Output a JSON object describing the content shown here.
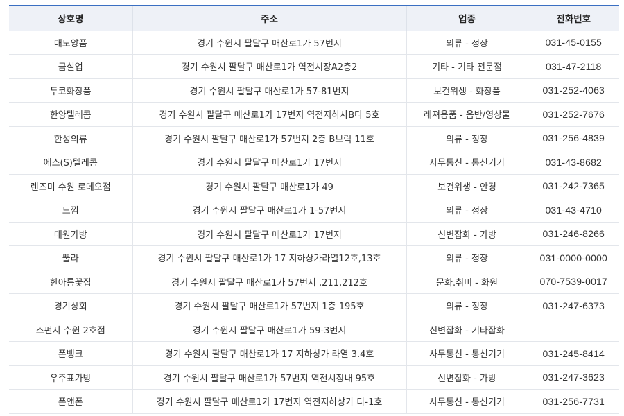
{
  "table": {
    "headers": [
      "상호명",
      "주소",
      "업종",
      "전화번호"
    ],
    "rows": [
      {
        "name": "대도양품",
        "address": "경기 수원시 팔달구 매산로1가 57번지",
        "category": "의류 - 정장",
        "phone": "031-45-0155"
      },
      {
        "name": "금실업",
        "address": "경기 수원시 팔달구 매산로1가 역전시장A2층2",
        "category": "기타 - 기타 전문점",
        "phone": "031-47-2118"
      },
      {
        "name": "두코화장품",
        "address": "경기 수원시 팔달구 매산로1가 57-81번지",
        "category": "보건위생 - 화장품",
        "phone": "031-252-4063"
      },
      {
        "name": "한양텔레콤",
        "address": "경기 수원시 팔달구 매산로1가 17번지 역전지하사B다 5호",
        "category": "레져용품 - 음반/영상물",
        "phone": "031-252-7676"
      },
      {
        "name": "한성의류",
        "address": "경기 수원시 팔달구 매산로1가 57번지 2층 B브럭 11호",
        "category": "의류 - 정장",
        "phone": "031-256-4839"
      },
      {
        "name": "에스(S)텔레콤",
        "address": "경기 수원시 팔달구 매산로1가 17번지",
        "category": "사무통신 - 통신기기",
        "phone": "031-43-8682"
      },
      {
        "name": "렌즈미 수원 로데오점",
        "address": "경기 수원시 팔달구 매산로1가 49",
        "category": "보건위생 - 안경",
        "phone": "031-242-7365"
      },
      {
        "name": "느낌",
        "address": "경기 수원시 팔달구 매산로1가 1-57번지",
        "category": "의류 - 정장",
        "phone": "031-43-4710"
      },
      {
        "name": "대원가방",
        "address": "경기 수원시 팔달구 매산로1가 17번지",
        "category": "신변잡화 - 가방",
        "phone": "031-246-8266"
      },
      {
        "name": "뿔라",
        "address": "경기 수원시 팔달구 매산로1가 17 지하상가라열12호,13호",
        "category": "의류 - 정장",
        "phone": "031-0000-0000"
      },
      {
        "name": "한아름꽃집",
        "address": "경기 수원시 팔달구 매산로1가 57번지 ,211,212호",
        "category": "문화.취미 - 화원",
        "phone": "070-7539-0017"
      },
      {
        "name": "경기상회",
        "address": "경기 수원시 팔달구 매산로1가 57번지 1층 195호",
        "category": "의류 - 정장",
        "phone": "031-247-6373"
      },
      {
        "name": "스펀지 수원 2호점",
        "address": "경기 수원시 팔달구 매산로1가 59-3번지",
        "category": "신변잡화 - 기타잡화",
        "phone": ""
      },
      {
        "name": "폰뱅크",
        "address": "경기 수원시 팔달구 매산로1가 17 지하상가 라열 3.4호",
        "category": "사무통신 - 통신기기",
        "phone": "031-245-8414"
      },
      {
        "name": "우주표가방",
        "address": "경기 수원시 팔달구 매산로1가 57번지 역전시장내 95호",
        "category": "신변잡화 - 가방",
        "phone": "031-247-3623"
      },
      {
        "name": "폰앤폰",
        "address": "경기 수원시 팔달구 매산로1가 17번지 역전지하상가 다-1호",
        "category": "사무통신 - 통신기기",
        "phone": "031-256-7731"
      }
    ]
  }
}
